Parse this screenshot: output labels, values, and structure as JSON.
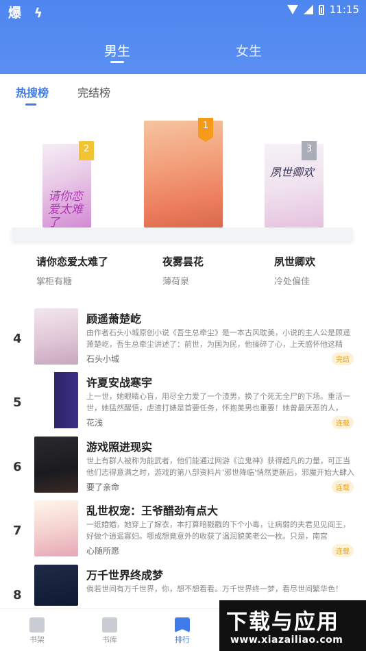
{
  "status_bar": {
    "left_icons": "爆 ϟ",
    "time": "11:15"
  },
  "gender_tabs": [
    {
      "label": "男生"
    },
    {
      "label": "女生"
    }
  ],
  "sub_tabs": [
    {
      "label": "热搜榜"
    },
    {
      "label": "完结榜"
    }
  ],
  "podium": [
    {
      "rank": "2",
      "title": "请你恋爱太难了",
      "author": "掌柜有糖",
      "cover_text": "请你恋爱太难了"
    },
    {
      "rank": "1",
      "title": "夜雾昙花",
      "author": "薄荷泉"
    },
    {
      "rank": "3",
      "title": "夙世卿欢",
      "author": "冷处偏佳",
      "cover_text": "夙世卿欢"
    }
  ],
  "list": [
    {
      "rank": "4",
      "title": "顾遥萧楚屹",
      "desc": "由作者石头小城原创小说《吾生总牵尘》是一本古风耽美，小说的主人公是顾遥萧楚屹，吾生总牵尘讲述了：前世，为国为民，他操碎了心，上天感怀他这精",
      "author": "石头小城",
      "status": "完结"
    },
    {
      "rank": "5",
      "title": "许夏安战寒宇",
      "desc": "上一世，她眼睛心盲，用尽全力爱了一个渣男，换了个死无全尸的下场。重活一世，她猛然醒悟，虐渣打婊是首要任务，怀抱美男也重要！她曾最厌恶的人，",
      "author": "花浅",
      "status": "连载"
    },
    {
      "rank": "6",
      "title": "游戏照进现实",
      "desc": "世上有群人被称为能武者，他们能通过网游《泣鬼神》获得超凡的力量，可正当他们志得意满之时，游戏的第八部资料片'邪世降临'悄然更新后，邪魔开始大肆入",
      "author": "要了亲命",
      "status": "连载"
    },
    {
      "rank": "7",
      "title": "乱世权宠：王爷醋劲有点大",
      "desc": "一纸婚婚，她穿上了嫁衣，本打算暗戳戳的下个小毒，让病弱的夫君见见阎王，好做个逍遥寡妇。哪成想竟意外的收获了温润貌美老公一枚。只是，南宫",
      "author": "心随所愿",
      "status": "连载"
    },
    {
      "rank": "8",
      "title": "万千世界终成梦",
      "desc": "倘若世间有万千世界，你，想不想看看。万千世界终一梦，看尽世间繁华色！",
      "author": "",
      "status": ""
    }
  ],
  "bottom_nav": [
    {
      "label": "书架"
    },
    {
      "label": "书库"
    },
    {
      "label": "排行"
    }
  ],
  "watermark": {
    "title": "下载与应用",
    "url": "www.xiazailiao.com"
  },
  "colors": {
    "header_blue": "#5a8ff3",
    "accent": "#3f7bea",
    "status_tag": "#e3a422"
  }
}
